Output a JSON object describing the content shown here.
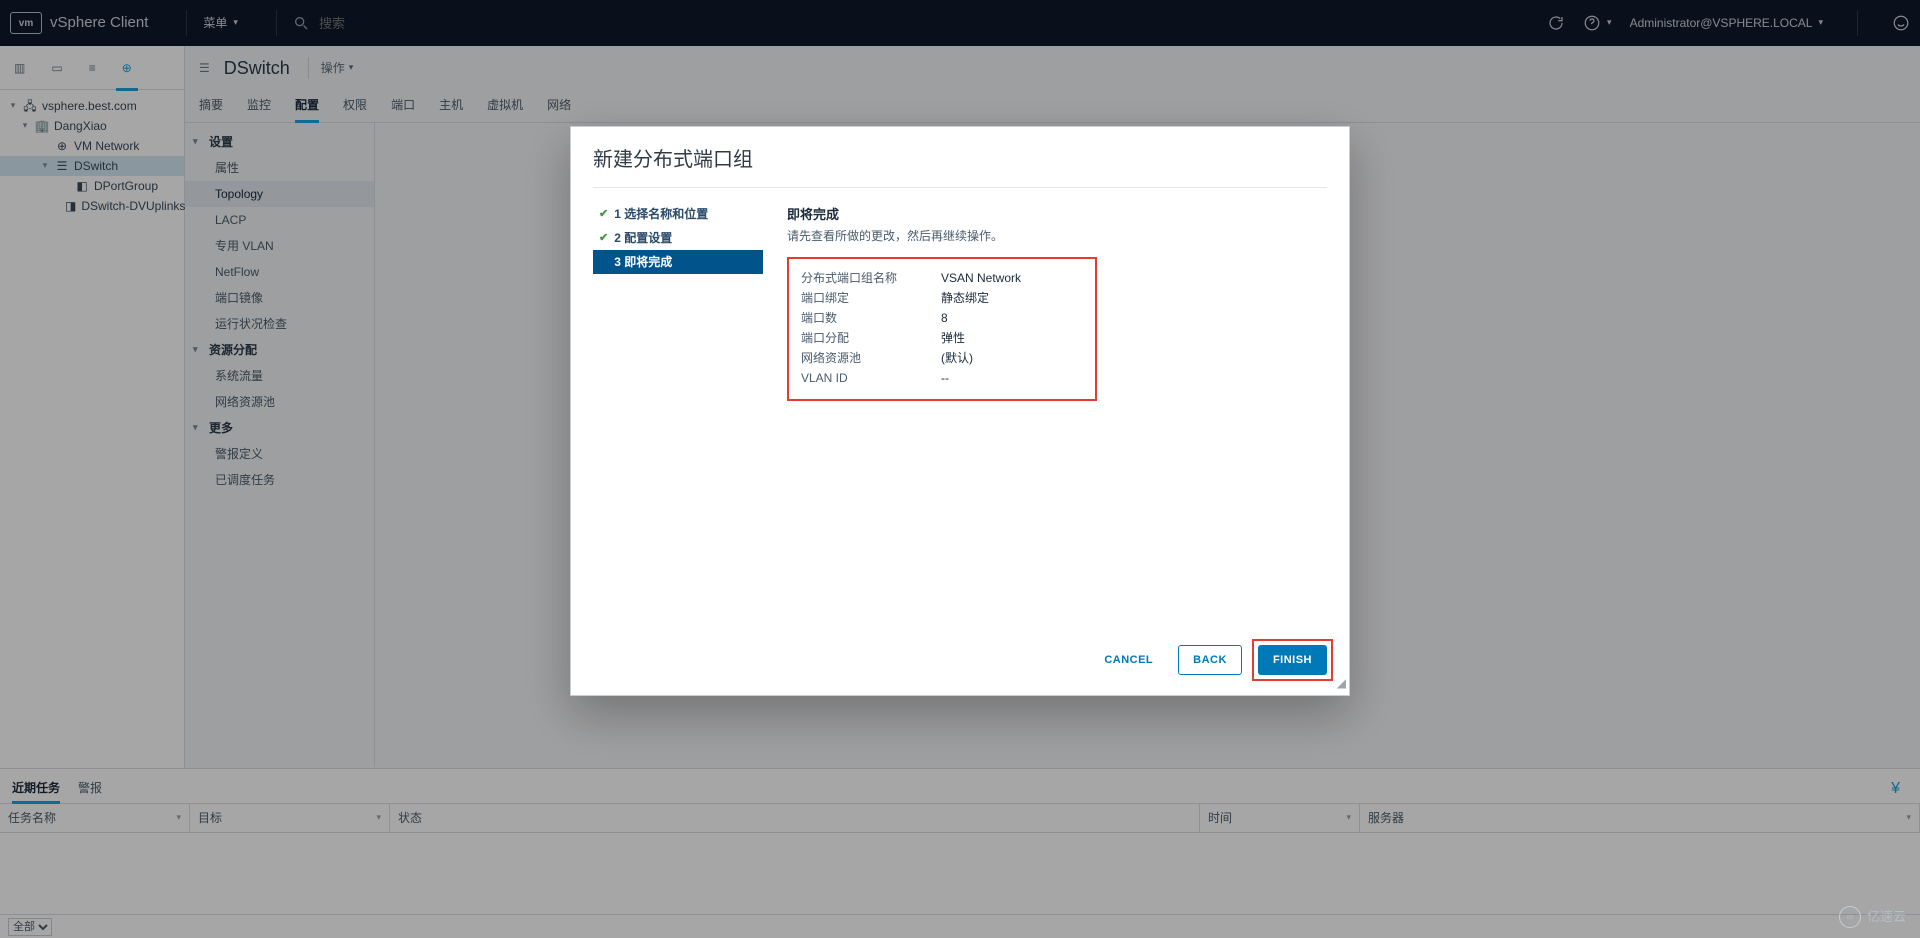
{
  "topbar": {
    "brand": "vSphere Client",
    "menu": "菜单",
    "search_placeholder": "搜索",
    "user": "Administrator@VSPHERE.LOCAL"
  },
  "tree": {
    "root": "vsphere.best.com",
    "dc": "DangXiao",
    "net1": "VM Network",
    "dswitch": "DSwitch",
    "pg1": "DPortGroup",
    "pg2": "DSwitch-DVUplinks…"
  },
  "page": {
    "title": "DSwitch",
    "actions": "操作"
  },
  "tabs": {
    "summary": "摘要",
    "monitor": "监控",
    "configure": "配置",
    "perm": "权限",
    "ports": "端口",
    "hosts": "主机",
    "vms": "虚拟机",
    "network": "网络"
  },
  "cfg": {
    "group_settings": "设置",
    "attr": "属性",
    "topo": "Topology",
    "lacp": "LACP",
    "pvlan": "专用 VLAN",
    "netflow": "NetFlow",
    "mirror": "端口镜像",
    "health": "运行状况检查",
    "group_res": "资源分配",
    "sysflow": "系统流量",
    "netpool": "网络资源池",
    "group_more": "更多",
    "alarmdef": "警报定义",
    "sched": "已调度任务"
  },
  "modal": {
    "title": "新建分布式端口组",
    "step1": "1 选择名称和位置",
    "step2": "2 配置设置",
    "step3": "3 即将完成",
    "pane_title": "即将完成",
    "pane_hint": "请先查看所做的更改，然后再继续操作。",
    "summary": {
      "k_name": "分布式端口组名称",
      "v_name": "VSAN Network",
      "k_bind": "端口绑定",
      "v_bind": "静态绑定",
      "k_num": "端口数",
      "v_num": "8",
      "k_alloc": "端口分配",
      "v_alloc": "弹性",
      "k_pool": "网络资源池",
      "v_pool": "(默认)",
      "k_vlan": "VLAN ID",
      "v_vlan": "--"
    },
    "btn_cancel": "CANCEL",
    "btn_back": "BACK",
    "btn_finish": "FINISH"
  },
  "tasks": {
    "tab_recent": "近期任务",
    "tab_alarm": "警报",
    "col_name": "任务名称",
    "col_target": "目标",
    "col_status": "状态",
    "col_time": "时间",
    "col_server": "服务器",
    "filter_all": "全部"
  },
  "watermark": "亿速云"
}
